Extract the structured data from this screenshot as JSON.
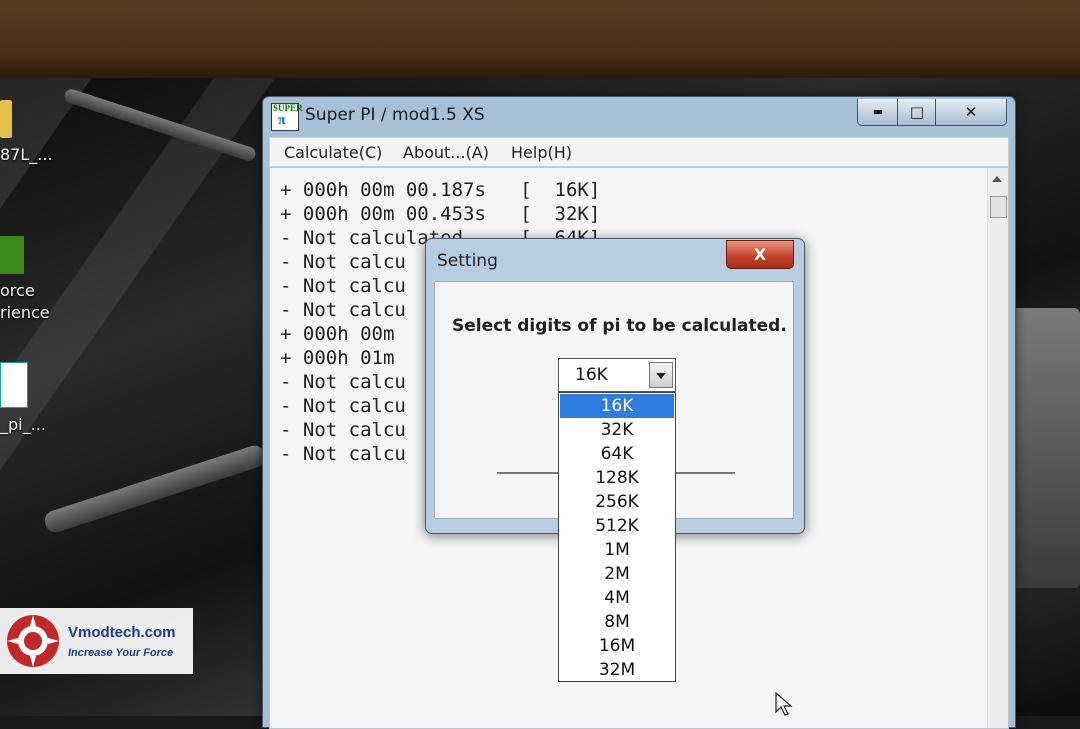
{
  "desktop": {
    "icons": [
      {
        "label_lines": [
          "87L_..."
        ]
      },
      {
        "label_lines": [
          "orce",
          "rience"
        ]
      },
      {
        "label_lines": [
          "_pi_..."
        ]
      }
    ],
    "watermark": {
      "title": "Vmodtech.com",
      "subtitle": "Increase Your Force"
    }
  },
  "window": {
    "title": "Super PI / mod1.5 XS",
    "controls": {
      "minimize": "▬",
      "maximize": "□",
      "close": "✕"
    },
    "menu": [
      "Calculate(C)",
      "About...(A)",
      "Help(H)"
    ],
    "log": [
      "+ 000h 00m 00.187s   [  16K]",
      "+ 000h 00m 00.453s   [  32K]",
      "- Not calculated     [  64K]",
      "- Not calcu",
      "- Not calcu",
      "- Not calcu",
      "+ 000h 00m",
      "+ 000h 01m",
      "- Not calcu",
      "- Not calcu",
      "- Not calcu",
      "- Not calcu"
    ]
  },
  "dialog": {
    "title": "Setting",
    "close_label": "X",
    "prompt": "Select digits of pi to be calculated.",
    "selected": "16K",
    "options": [
      "16K",
      "32K",
      "64K",
      "128K",
      "256K",
      "512K",
      "1M",
      "2M",
      "4M",
      "8M",
      "16M",
      "32M"
    ]
  },
  "colors": {
    "selection": "#2f7ddc",
    "close_button": "#c2402a",
    "watermark_text": "#1b3d8a"
  }
}
